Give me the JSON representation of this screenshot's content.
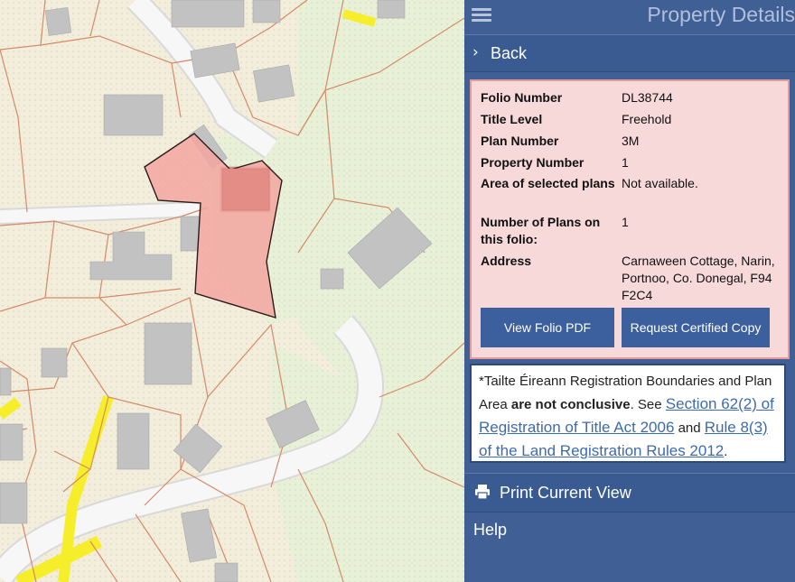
{
  "header": {
    "title": "Property Details",
    "menu_icon": "hamburger-icon"
  },
  "back": {
    "label": "Back",
    "icon": "chevron-right-icon"
  },
  "property": {
    "rows": [
      {
        "label": "Folio Number",
        "value": "DL38744"
      },
      {
        "label": "Title Level",
        "value": "Freehold"
      },
      {
        "label": "Plan Number",
        "value": "3M"
      },
      {
        "label": "Property Number",
        "value": "1"
      },
      {
        "label": "Area of selected plans",
        "value": "Not available."
      },
      {
        "label": "Number of Plans on this folio:",
        "value": "1"
      },
      {
        "label": "Address",
        "value": "Carnaween Cottage, Narin, Portnoo, Co. Donegal, F94 F2C4"
      }
    ],
    "view_pdf_label": "View Folio PDF",
    "certified_copy_label": "Request Certified Copy"
  },
  "notice": {
    "text_1": "*Tailte Éireann Registration Boundaries and Plan Area ",
    "bold": "are not conclusive",
    "text_2": ". See ",
    "link_1": "Section 62(2) of Registration of Title Act 2006",
    "text_3": " and ",
    "link_2": "Rule 8(3) of the Land Registration Rules 2012",
    "text_4": "."
  },
  "print": {
    "label": "Print Current View",
    "icon": "printer-icon"
  },
  "help": {
    "label": "Help"
  },
  "colors": {
    "panel_bg": "#3f5f95",
    "button_bg": "#3c5f9e",
    "details_bg": "#f7d9d9",
    "details_border": "#e29a9a",
    "selected_parcel": "#f2a6a0",
    "map_land": "#f3eedc",
    "map_green": "#e8f0d8",
    "road_yellow": "#f6ee2a",
    "link": "#3d6bb0"
  }
}
